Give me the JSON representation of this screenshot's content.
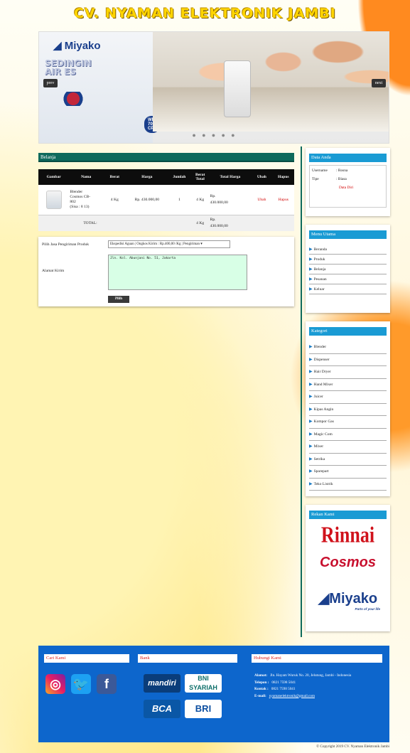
{
  "header": {
    "title": "CV. NYAMAN ELEKTRONIK JAMBI"
  },
  "slider": {
    "brand": "Miyako",
    "promo_line1": "SEDINGIN",
    "promo_line2": "AIR ES",
    "prev_label": "prev",
    "next_label": "next",
    "model_label": "WD-700 CP",
    "dots": "● ● ● ● ●"
  },
  "cart": {
    "section_title": "Belanja",
    "columns": [
      "Gambar",
      "Nama",
      "Berat",
      "Harga",
      "Jumlah",
      "Berat Total",
      "Total Harga",
      "Ubah",
      "Hapus"
    ],
    "item": {
      "name_line1": "Blender",
      "name_line2": "Cosmos   CB-",
      "name_line3": "802",
      "name_line4": "(Sisa : 8 13)",
      "weight": "4 Kg",
      "price": "Rp. 430.000,00",
      "qty": "1",
      "total_weight": "4 Kg",
      "total_price_1": "Rp.",
      "total_price_2": "430.000,00",
      "edit": "Ubah",
      "delete": "Hapus"
    },
    "total_row": {
      "label": "TOTAL:",
      "weight": "4 Kg",
      "price_1": "Rp.",
      "price_2": "430.000,00"
    }
  },
  "shipping_form": {
    "shipping_label": "Pilih Jasa Pengiriman Produk",
    "shipping_selected": "Ekspedisi Aguan | Ongkos Kirim : Rp.400,00 /Kg | Pengiriman",
    "address_label": "Alamat Kirim",
    "address_value": "Jln. Kol. Abunjani No. 51, Jakarta",
    "submit_label": "Pilih"
  },
  "sidebar": {
    "user_box": {
      "title": "Data Anda",
      "username_label": "Username",
      "username_value": ": Rosna",
      "type_label": "Tipe",
      "type_value": ": Biasa",
      "edit_link": "Data Diri"
    },
    "main_menu": {
      "title": "Menu Utama",
      "items": [
        "Beranda",
        "Produk",
        "Belanja",
        "Pesanan",
        "Keluar"
      ]
    },
    "categories": {
      "title": "Kategori",
      "items": [
        "Blender",
        "Dispenser",
        "Hair Dryer",
        "Hand Mixer",
        "Juicer",
        "Kipas Angin",
        "Kompor Gas",
        "Magic Com",
        "Mixer",
        "Setrika",
        "Sparepart",
        "Teko Listrik"
      ]
    },
    "partners": {
      "title": "Rekan Kami",
      "logos": [
        "Rinnai",
        "Cosmos",
        "Miyako"
      ],
      "miyako_tagline": "Parts of your life"
    }
  },
  "footer": {
    "find_us_title": "Cari Kami",
    "social": [
      "instagram-icon",
      "twitter-icon",
      "facebook-icon"
    ],
    "bank_title": "Bank",
    "banks": [
      "mandiri",
      "BNI SYARIAH",
      "BCA",
      "BRI"
    ],
    "contact_title": "Hubungi Kami",
    "address_label": "Alamat:",
    "address_value": "Jln. Hayam Wuruk No. 20, Jelutung, Jambi - Indonesia",
    "phone_label": "Telepon :",
    "phone_value": "0821 7598 5041",
    "contact_label": "Kontak :",
    "contact_value": "0821 7598 5041",
    "email_label": "E-mail:",
    "email_value": "nyamanelektronik@gmail.com"
  },
  "copyright": "© Copyright 2019 CV. Nyaman Elektronik Jambi",
  "colors": {
    "title": "#ffd500",
    "section_bar": "#0e6a5c",
    "sidebar_head": "#1a9bd4",
    "footer": "#0d66cc",
    "link_red": "#d20000"
  }
}
